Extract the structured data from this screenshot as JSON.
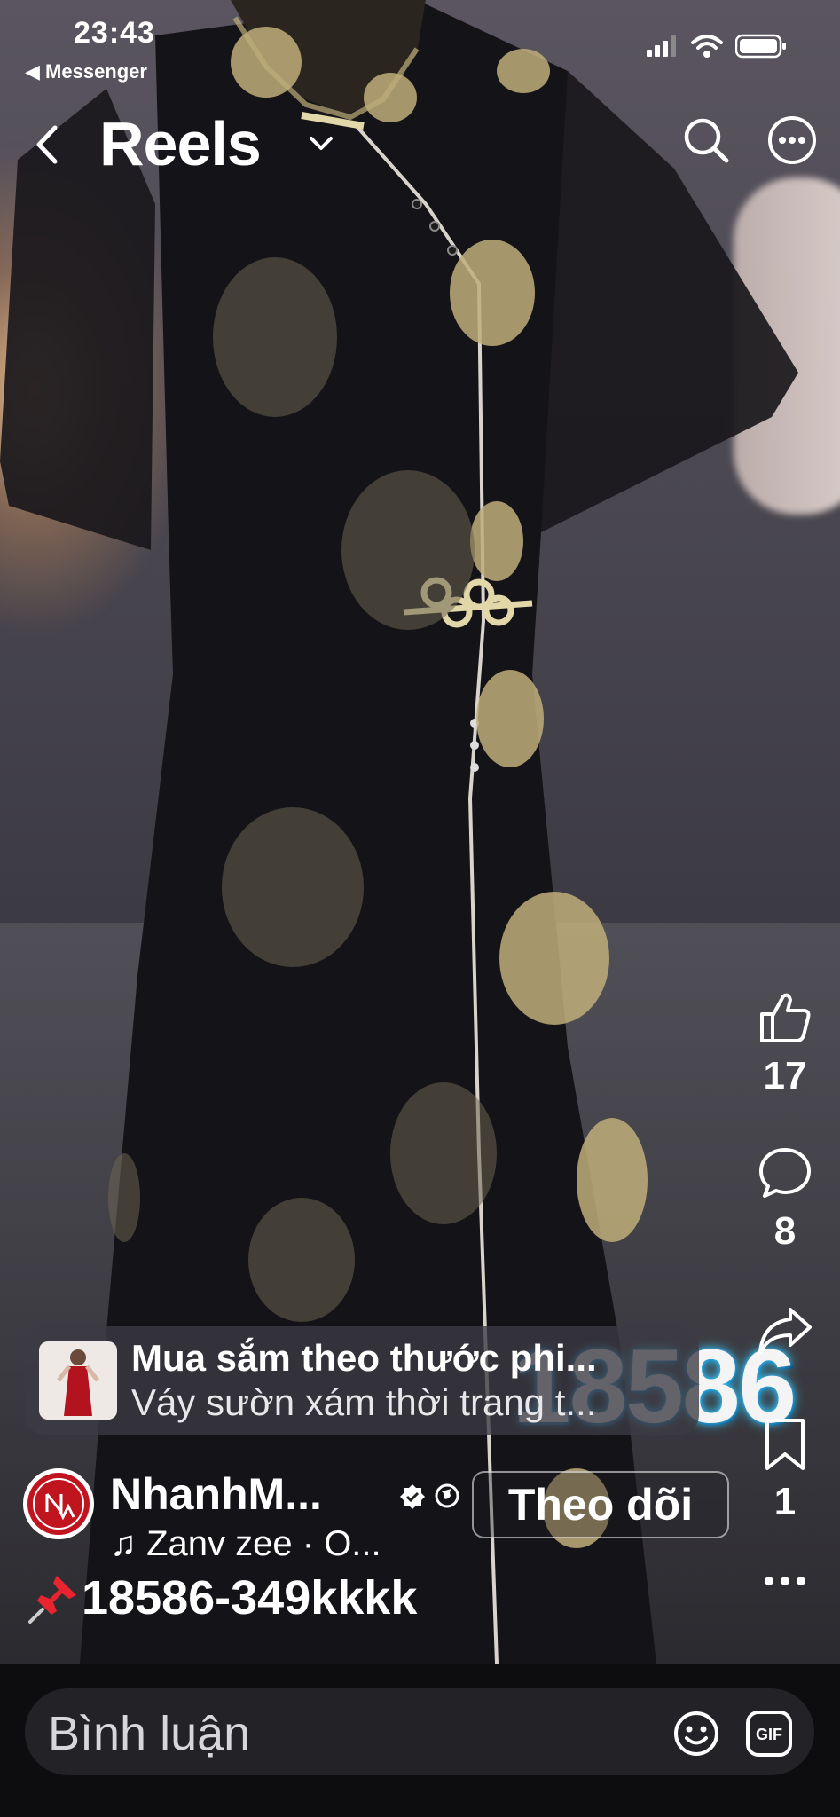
{
  "status_bar": {
    "time": "23:43",
    "back_app": "◀ Messenger"
  },
  "header": {
    "title": "Reels"
  },
  "actions": {
    "like_count": "17",
    "comment_count": "8",
    "save_count": "1"
  },
  "overlay_text": "18586",
  "shop_card": {
    "title": "Mua sắm theo thước phi...",
    "subtitle": "Váy sườn xám thời trang t..."
  },
  "author": {
    "name": "NhanhM...",
    "follow_label": "Theo dõi",
    "music": "♫ Zanv zee · O..."
  },
  "caption": "18586-349kkkk",
  "comment_bar": {
    "placeholder": "Bình luận"
  },
  "colors": {
    "accent_overlay_glow": "#3ad0ff",
    "dress_black": "#141317",
    "print_gold": "#bfae7a",
    "avatar_red": "#c0141e"
  },
  "icons": [
    "back-icon",
    "chevron-down-icon",
    "search-icon",
    "more-icon",
    "like-icon",
    "comment-icon",
    "share-icon",
    "save-icon",
    "more-horizontal-icon",
    "verified-icon",
    "globe-icon",
    "pin-icon",
    "emoji-icon",
    "gif-icon"
  ]
}
